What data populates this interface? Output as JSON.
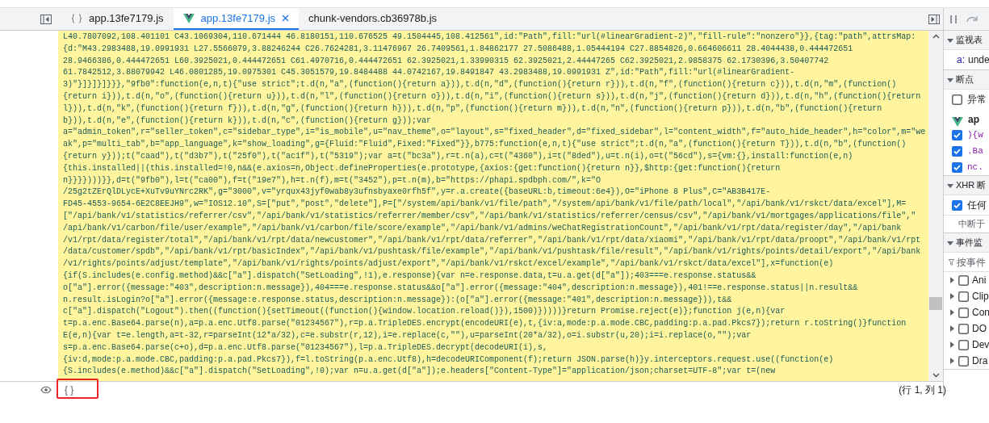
{
  "tabs": [
    {
      "label": "app.13fe7179.js",
      "kind": "script",
      "selected": false,
      "closable": false
    },
    {
      "label": "app.13fe7179.js",
      "kind": "vue",
      "selected": true,
      "closable": true
    },
    {
      "label": "chunk-vendors.cb36978b.js",
      "kind": "plain",
      "selected": false,
      "closable": false
    }
  ],
  "code": {
    "lines": [
      "L40.7807092,108.401101 C43.1069304,110.671444 46.8180151,110.676525 49.1504445,108.412561\",id:\"Path\",fill:\"url(#linearGradient-2)\",\"fill-rule\":\"nonzero\"}},{tag:\"path\",attrsMap:",
      "{d:\"M43.2983488,19.0991931 L27.5566079,3.88246244 C26.7624281,3.11476967 26.7409561,1.84862177 27.5086488,1.05444194 C27.8854826,0.664606611 28.4044438,0.444472651",
      "28.9466386,0.444472651 L60.3925021,0.444472651 C61.4970716,0.444472651 62.3925021,1.33990315 62.3925021,2.44447265 C62.3925021,2.9858375 62.1730396,3.50407742",
      "61.7842512,3.88079942 L46.0801285,19.0975301 C45.3051579,19.8484488 44.0742167,19.8491847 43.2983488,19.0991931 Z\",id:\"Path\",fill:\"url(#linearGradient-",
      "3)\"}]}]}]}}},\"9fb0\":function(e,n,t){\"use strict\";t.d(n,\"a\",(function(){return a})),t.d(n,\"d\",(function(){return r})),t.d(n,\"f\",(function(){return c})),t.d(n,\"m\",(function()",
      "{return i})),t.d(n,\"o\",(function(){return u})),t.d(n,\"l\",(function(){return o})),t.d(n,\"i\",(function(){return s})),t.d(n,\"j\",(function(){return d})),t.d(n,\"h\",(function(){return",
      "l})),t.d(n,\"k\",(function(){return f})),t.d(n,\"g\",(function(){return h})),t.d(n,\"p\",(function(){return m})),t.d(n,\"n\",(function(){return p})),t.d(n,\"b\",(function(){return",
      "b})),t.d(n,\"e\",(function(){return k})),t.d(n,\"c\",(function(){return g}));var",
      "a=\"admin_token\",r=\"seller_token\",c=\"sidebar_type\",i=\"is_mobile\",u=\"nav_theme\",o=\"layout\",s=\"fixed_header\",d=\"fixed_sidebar\",l=\"content_width\",f=\"auto_hide_header\",h=\"color\",m=\"we",
      "ak\",p=\"multi_tab\",b=\"app_language\",k=\"show_loading\",g={Fluid:\"Fluid\",Fixed:\"Fixed\"}},b775:function(e,n,t){\"use strict\";t.d(n,\"a\",(function(){return T})),t.d(n,\"b\",(function()",
      "{return y}));t(\"caad\"),t(\"d3b7\"),t(\"25f0\"),t(\"ac1f\"),t(\"5319\");var a=t(\"bc3a\"),r=t.n(a),c=t(\"4360\"),i=t(\"8ded\"),u=t.n(i),o=t(\"56cd\"),s={vm:{},install:function(e,n)",
      "{this.installed||(this.installed=!0,n&&(e.axios=n,Object.defineProperties(e.prototype,{axios:{get:function(){return n}},$http:{get:function(){return",
      "n}}}})))}},d=t(\"9fb0\"),l=t(\"ca00\"),f=t(\"19e7\"),h=t.n(f),m=t(\"3452\"),p=t.n(m),b=\"https://phapi.spdbph.com/\",k=\"O",
      "/25g2tZErQlDLycE+XuTv9uYNrc2RK\",g=\"3000\",v=\"yrqux43jyf0wab8y3ufnsbyaxe0rfh5f\",y=r.a.create({baseURL:b,timeout:6e4}),O=\"iPhone 8 Plus\",C=\"AB3B417E-",
      "FD45-4553-9654-6E2C8EEJH9\",w=\"IOS12.10\",S=[\"put\",\"post\",\"delete\"],P=[\"/system/api/bank/v1/file/path\",\"/system/api/bank/v1/file/path/local\",\"/api/bank/v1/rskct/data/excel\"],M=",
      "[\"/api/bank/v1/statistics/referrer/csv\",\"/api/bank/v1/statistics/referrer/member/csv\",\"/api/bank/v1/statistics/referrer/census/csv\",\"/api/bank/v1/mortgages/applications/file\",\"",
      "/api/bank/v1/carbon/file/user/example\",\"/api/bank/v1/carbon/file/score/example\",\"/api/bank/v1/admins/weChatRegistrationCount\",\"/api/bank/v1/rpt/data/register/day\",\"/api/bank",
      "/v1/rpt/data/register/total\",\"/api/bank/v1/rpt/data/newcustomer\",\"/api/bank/v1/rpt/data/referrer\",\"/api/bank/v1/rpt/data/xiaomi\",\"/api/bank/v1/rpt/data/proopt\",\"/api/bank/v1/rpt",
      "/data/customer/spdb\",\"/api/bank/v1/rpt/basicIndex\",\"/api/bank/v1/pushtask/file/example\",\"/api/bank/v1/pushtask/file/result\",\"/api/bank/v1/rights/points/detail/export\",\"/api/bank",
      "/v1/rights/points/adjust/template\",\"/api/bank/v1/rights/points/adjust/export\",\"/api/bank/v1/rskct/excel/example\",\"/api/bank/v1/rskct/data/excel\"],x=function(e)",
      "{if(S.includes(e.config.method)&&c[\"a\"].dispatch(\"SetLoading\",!1),e.response){var n=e.response.data,t=u.a.get(d[\"a\"]);403===e.response.status&&",
      "o[\"a\"].error({message:\"403\",description:n.message}),404===e.response.status&&o[\"a\"].error({message:\"404\",description:n.message}),401!==e.response.status||n.result&&",
      "n.result.isLogin?o[\"a\"].error({message:e.response.status,description:n.message}):(o[\"a\"].error({message:\"401\",description:n.message})),t&&",
      "c[\"a\"].dispatch(\"Logout\").then((function(){setTimeout((function(){window.location.reload()}),1500)}))))}return Promise.reject(e)};function j(e,n){var",
      "t=p.a.enc.Base64.parse(n),a=p.a.enc.Utf8.parse(\"01234567\"),r=p.a.TripleDES.encrypt(encodeURI(e),t,{iv:a,mode:p.a.mode.CBC,padding:p.a.pad.Pkcs7});return r.toString()}function",
      "E(e,n){var t=e.length,a=t-32,r=parseInt(12*a/32),c=e.substr(r,12),i=e.replace(c,\"\"),u=parseInt(20*a/32),o=i.substr(u,20);i=i.replace(o,\"\");var",
      "s=p.a.enc.Base64.parse(c+o),d=p.a.enc.Utf8.parse(\"01234567\"),l=p.a.TripleDES.decrypt(decodeURI(i),s,",
      "{iv:d,mode:p.a.mode.CBC,padding:p.a.pad.Pkcs7}),f=l.toString(p.a.enc.Utf8),h=decodeURIComponent(f);return JSON.parse(h)}y.interceptors.request.use((function(e)",
      "{S.includes(e.method)&&c[\"a\"].dispatch(\"SetLoading\",!0);var n=u.a.get(d[\"a\"]);e.headers[\"Content-Type\"]=\"application/json;charset=UTF-8\";var t=(new"
    ]
  },
  "footer": {
    "pretty_print": "{ }",
    "highlighted": true,
    "cursor": "(行 1, 列 1)"
  },
  "sidebar": {
    "sections": [
      {
        "title": "监视表",
        "expanded": true,
        "items": [
          {
            "kind": "watch",
            "name": "a:",
            "value": "unde"
          }
        ]
      },
      {
        "title": "断点",
        "expanded": true,
        "items": [
          {
            "kind": "checkbox",
            "label": "异常",
            "checked": false
          },
          {
            "kind": "file",
            "label": "ap"
          },
          {
            "kind": "code",
            "label": "){w",
            "checked": true
          },
          {
            "kind": "code",
            "label": ".Ba",
            "checked": true
          },
          {
            "kind": "code",
            "label": "nc.",
            "checked": true
          }
        ]
      },
      {
        "title": "XHR 断",
        "expanded": true,
        "items": [
          {
            "kind": "checkbox",
            "label": "任何",
            "checked": true
          },
          {
            "kind": "note",
            "label": "中断于"
          }
        ]
      },
      {
        "title": "事件监",
        "expanded": true,
        "items": [
          {
            "kind": "filter",
            "placeholder": "按事件"
          },
          {
            "kind": "category",
            "label": "Ani",
            "checked": false,
            "expanded": false
          },
          {
            "kind": "category",
            "label": "Clip",
            "checked": false,
            "expanded": false
          },
          {
            "kind": "category",
            "label": "Con",
            "checked": false,
            "expanded": false
          },
          {
            "kind": "category",
            "label": "DO",
            "checked": false,
            "expanded": false
          },
          {
            "kind": "category",
            "label": "Dev",
            "checked": false,
            "expanded": false
          },
          {
            "kind": "category",
            "label": "Dra",
            "checked": false,
            "expanded": false
          }
        ]
      }
    ]
  }
}
